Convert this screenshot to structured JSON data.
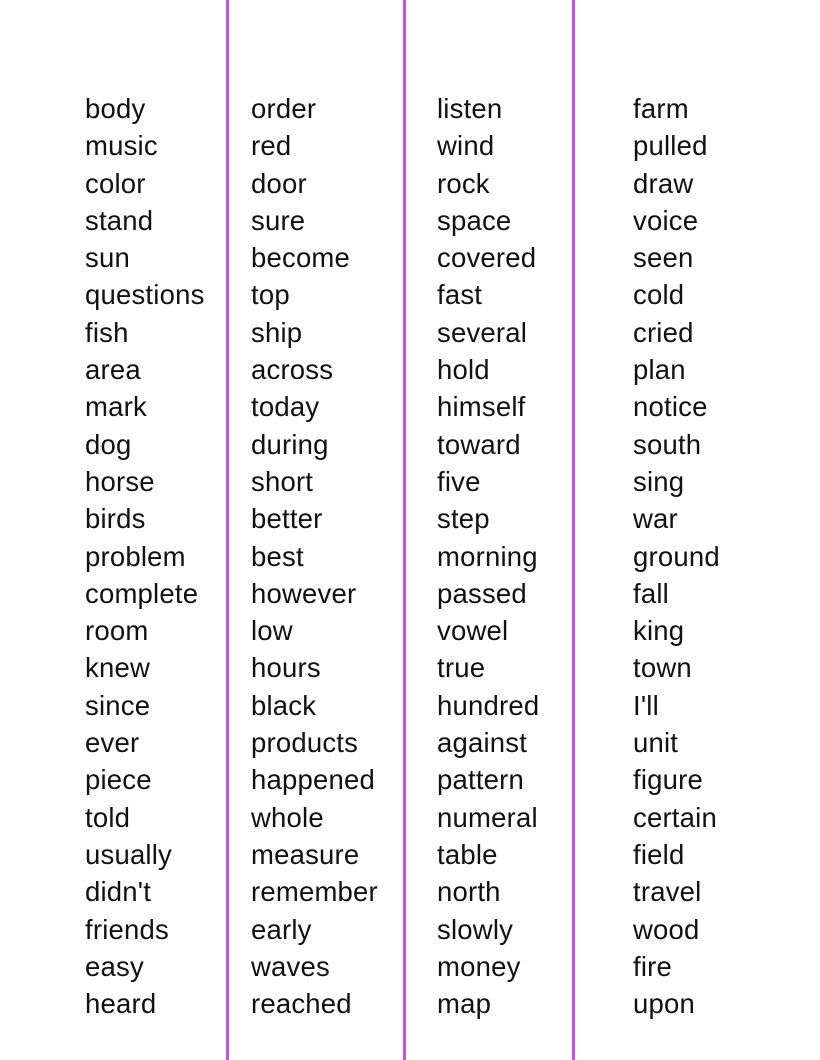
{
  "document": {
    "type": "sight word list",
    "divider_color": "#c94cec",
    "text_color": "#111111"
  },
  "columns": [
    {
      "words": [
        "body",
        "music",
        "color",
        "stand",
        "sun",
        "questions",
        "fish",
        "area",
        "mark",
        "dog",
        "horse",
        "birds",
        "problem",
        "complete",
        "room",
        "knew",
        "since",
        "ever",
        "piece",
        "told",
        "usually",
        "didn't",
        "friends",
        "easy",
        "heard"
      ]
    },
    {
      "words": [
        "order",
        "red",
        "door",
        "sure",
        "become",
        "top",
        "ship",
        "across",
        "today",
        "during",
        "short",
        "better",
        "best",
        "however",
        "low",
        "hours",
        "black",
        "products",
        "happened",
        "whole",
        "measure",
        "remember",
        "early",
        "waves",
        "reached"
      ]
    },
    {
      "words": [
        "listen",
        "wind",
        "rock",
        "space",
        "covered",
        "fast",
        "several",
        "hold",
        "himself",
        "toward",
        "five",
        "step",
        "morning",
        "passed",
        "vowel",
        "true",
        "hundred",
        "against",
        "pattern",
        "numeral",
        "table",
        "north",
        "slowly",
        "money",
        "map"
      ]
    },
    {
      "words": [
        "farm",
        "pulled",
        "draw",
        "voice",
        "seen",
        "cold",
        "cried",
        "plan",
        "notice",
        "south",
        "sing",
        "war",
        "ground",
        "fall",
        "king",
        "town",
        "I'll",
        "unit",
        "figure",
        "certain",
        "field",
        "travel",
        "wood",
        "fire",
        "upon"
      ]
    }
  ]
}
